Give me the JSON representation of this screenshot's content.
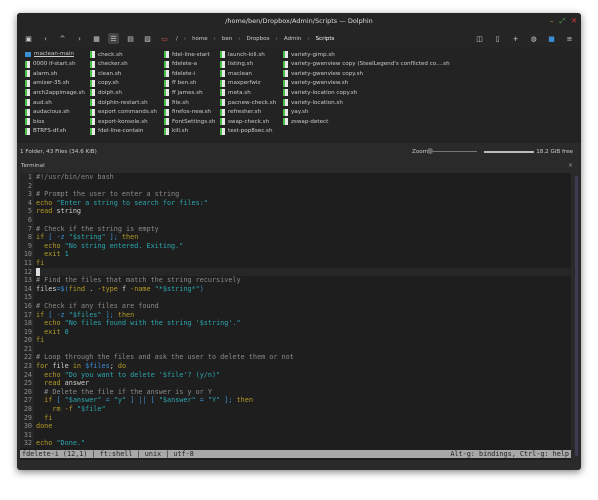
{
  "window": {
    "title": "/home/ben/Dropbox/Admin/Scripts — Dolphin"
  },
  "breadcrumb": [
    "/",
    "home",
    "ben",
    "Dropbox",
    "Admin",
    "Scripts"
  ],
  "files": [
    [
      "maclean-main",
      "0000 if-start.sh",
      "alarm.sh",
      "amixer-35.sh",
      "arch2appimage.sh",
      "aud.sh",
      "audacious.sh",
      "bios",
      "BTRFS-df.sh"
    ],
    [
      "check.sh",
      "checker.sh",
      "clean.sh",
      "copy.sh",
      "dolph.sh",
      "dolphin-restart.sh",
      "export commands.sh",
      "export-konsole.sh",
      "fdel-line-contain"
    ],
    [
      "fdel-line-start",
      "fdelete-a",
      "fdelete-i",
      "ff ben.sh",
      "ff james.sh",
      "file.sh",
      "firefox-new.sh",
      "FontSettings.sh",
      "kill.sh"
    ],
    [
      "launch-kill.sh",
      "listing.sh",
      "maclean",
      "maxperfwiz",
      "meta.sh",
      "pacnew-check.sh",
      "refresher.sh",
      "swap-check.sh",
      "test-pop8sec.sh"
    ],
    [
      "variety-gimp.sh",
      "variety-gwenview copy (SteelLegend's conflicted co....sh",
      "variety-gwenview copy.sh",
      "variety-gwenview.sh",
      "variety-location copy.sh",
      "variety-location.sh",
      "yay.sh",
      "zswap-detect"
    ]
  ],
  "status": {
    "summary": "1 Folder, 43 Files (34.6 KiB)",
    "zoom_label": "Zoom:",
    "free": "18.2 GiB free",
    "disk_used_fraction": 0.97
  },
  "terminal": {
    "title": "Terminal",
    "close": "×"
  },
  "code": [
    [
      [
        "#!/usr/bin/env bash",
        "c"
      ]
    ],
    [],
    [
      [
        "# Prompt the user to enter a string",
        "c"
      ]
    ],
    [
      [
        "echo ",
        "k"
      ],
      [
        "\"Enter a string to search for files:\"",
        "s"
      ]
    ],
    [
      [
        "read ",
        "k"
      ],
      [
        "string",
        "p"
      ]
    ],
    [],
    [
      [
        "# Check if the string is empty",
        "c"
      ]
    ],
    [
      [
        "if ",
        "k"
      ],
      [
        "[ -z ",
        "v"
      ],
      [
        "\"$string\"",
        "s"
      ],
      [
        " ]; ",
        "v"
      ],
      [
        "then",
        "k"
      ]
    ],
    [
      [
        "  echo ",
        "k"
      ],
      [
        "\"No string entered. Exiting.\"",
        "s"
      ]
    ],
    [
      [
        "  exit ",
        "k"
      ],
      [
        "1",
        "s"
      ]
    ],
    [
      [
        "fi",
        "k"
      ]
    ],
    [],
    [
      [
        "# Find the files that match the string recursively",
        "c"
      ]
    ],
    [
      [
        "files",
        "p"
      ],
      [
        "=$(",
        "v"
      ],
      [
        "find",
        "k"
      ],
      [
        " . ",
        "p"
      ],
      [
        "-type",
        "k"
      ],
      [
        " f ",
        "p"
      ],
      [
        "-name",
        "k"
      ],
      [
        " \"*$string*\"",
        "s"
      ],
      [
        ")",
        "v"
      ]
    ],
    [],
    [
      [
        "# Check if any files are found",
        "c"
      ]
    ],
    [
      [
        "if ",
        "k"
      ],
      [
        "[ -z ",
        "v"
      ],
      [
        "\"$files\"",
        "s"
      ],
      [
        " ]; ",
        "v"
      ],
      [
        "then",
        "k"
      ]
    ],
    [
      [
        "  echo ",
        "k"
      ],
      [
        "\"No files found with the string '$string'.\"",
        "s"
      ]
    ],
    [
      [
        "  exit ",
        "k"
      ],
      [
        "0",
        "s"
      ]
    ],
    [
      [
        "fi",
        "k"
      ]
    ],
    [],
    [
      [
        "# Loop through the files and ask the user to delete them or not",
        "c"
      ]
    ],
    [
      [
        "for ",
        "k"
      ],
      [
        "file ",
        "p"
      ],
      [
        "in ",
        "k"
      ],
      [
        "$files",
        "v"
      ],
      [
        "; ",
        "p"
      ],
      [
        "do",
        "k"
      ]
    ],
    [
      [
        "  echo ",
        "k"
      ],
      [
        "\"Do you want to delete '$file'? (y/n)\"",
        "s"
      ]
    ],
    [
      [
        "  read ",
        "k"
      ],
      [
        "answer",
        "p"
      ]
    ],
    [
      [
        "  # Delete the file if the answer is y or Y",
        "c"
      ]
    ],
    [
      [
        "  if ",
        "k"
      ],
      [
        "[ ",
        "v"
      ],
      [
        "\"$answer\"",
        "s"
      ],
      [
        " = ",
        "v"
      ],
      [
        "\"y\"",
        "s"
      ],
      [
        " ] || [ ",
        "v"
      ],
      [
        "\"$answer\"",
        "s"
      ],
      [
        " = ",
        "v"
      ],
      [
        "\"Y\"",
        "s"
      ],
      [
        " ]; ",
        "v"
      ],
      [
        "then",
        "k"
      ]
    ],
    [
      [
        "    rm -f ",
        "k"
      ],
      [
        "\"$file\"",
        "s"
      ]
    ],
    [
      [
        "  fi",
        "k"
      ]
    ],
    [
      [
        "done",
        "k"
      ]
    ],
    [],
    [
      [
        "echo ",
        "k"
      ],
      [
        "\"Done.\"",
        "s"
      ]
    ]
  ],
  "cursor_line": 12,
  "editor_status": {
    "left": "fdelete-i (12,1) | ft:shell | unix | utf-8",
    "right": "Alt-g: bindings, Ctrl-g: help"
  }
}
